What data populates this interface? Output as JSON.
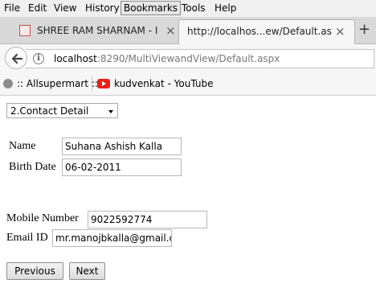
{
  "menu": [
    "File",
    "Edit",
    "View",
    "History",
    "Bookmarks",
    "Tools",
    "Help"
  ],
  "tabs": [
    {
      "title": "SHREE RAM SHARNAM - I...",
      "close": "×"
    },
    {
      "title": "http://localhos...ew/Default.aspx",
      "close": "×"
    }
  ],
  "new_tab": "+",
  "url": {
    "host": "localhost",
    "rest": ":8290/MultiViewandView/Default.aspx"
  },
  "bookmarks": [
    ":: Allsupermart ::",
    "kudvenkat - YouTube"
  ],
  "form": {
    "step_select": "2.Contact Detail",
    "name_label": "Name",
    "name_value": "Suhana Ashish Kalla",
    "birth_label": "Birth Date",
    "birth_value": "06-02-2011",
    "mobile_label": "Mobile Number",
    "mobile_value": "9022592774",
    "email_label": "Email ID",
    "email_value": "mr.manojbkalla@gmail.c",
    "previous": "Previous",
    "next": "Next"
  },
  "colors": {
    "youtube": "#e62117",
    "accent_tab_icon": "#c0504d"
  }
}
